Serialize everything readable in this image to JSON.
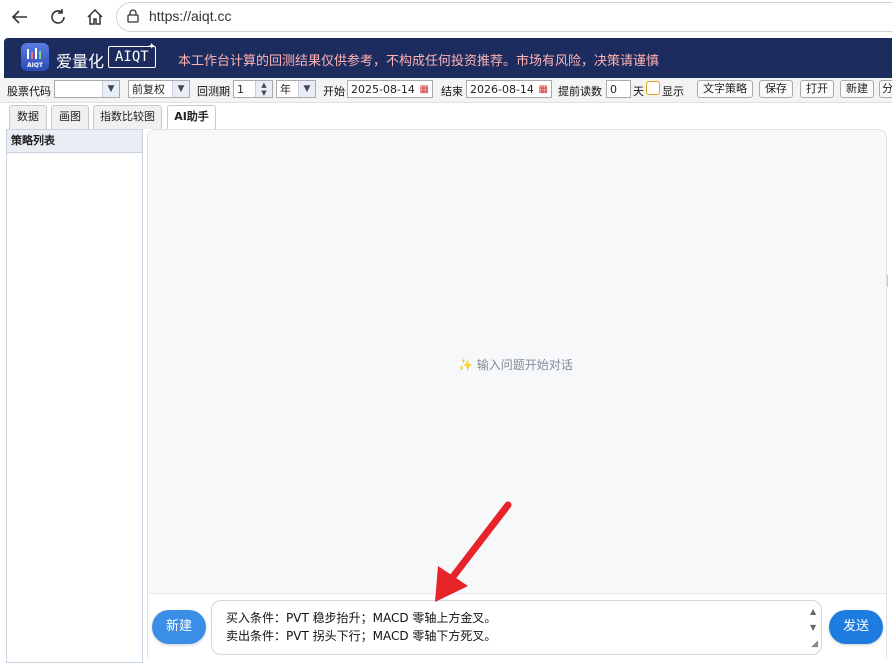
{
  "browser": {
    "url": "https://aiqt.cc"
  },
  "header": {
    "app_name": "爱量化",
    "brand": "AIQT",
    "logo_text": "AIQT",
    "disclaimer": "本工作台计算的回测结果仅供参考，不构成任何投资推荐。市场有风险，决策请谨慎"
  },
  "toolbar": {
    "stock_code_label": "股票代码",
    "stock_code_value": "",
    "adjust_value": "前复权",
    "period_label": "回测期",
    "period_value": "1",
    "period_unit": "年",
    "start_label": "开始",
    "start_date": "2025-08-14",
    "end_label": "结束",
    "end_date": "2026-08-14",
    "advance_label": "提前读数",
    "advance_value": "0",
    "advance_unit": "天",
    "show_label": "显示",
    "text_strategy": "文字策略",
    "save": "保存",
    "open": "打开",
    "new": "新建",
    "cut_off": "分"
  },
  "tabs": [
    {
      "label": "数据"
    },
    {
      "label": "画图"
    },
    {
      "label": "指数比较图"
    },
    {
      "label": "AI助手"
    }
  ],
  "sidebar": {
    "title": "策略列表"
  },
  "chat": {
    "empty_hint": "输入问题开始对话",
    "input_line1": "买入条件：PVT 稳步抬升；MACD 零轴上方金叉。",
    "input_line2": "卖出条件：PVT 拐头下行；MACD 零轴下方死叉。",
    "new_button": "新建",
    "send_button": "发送"
  },
  "colors": {
    "header_bg": "#1c2c5e",
    "accent": "#1e7be0",
    "arrow": "#e8242b",
    "disclaimer": "#ffb3b3"
  }
}
